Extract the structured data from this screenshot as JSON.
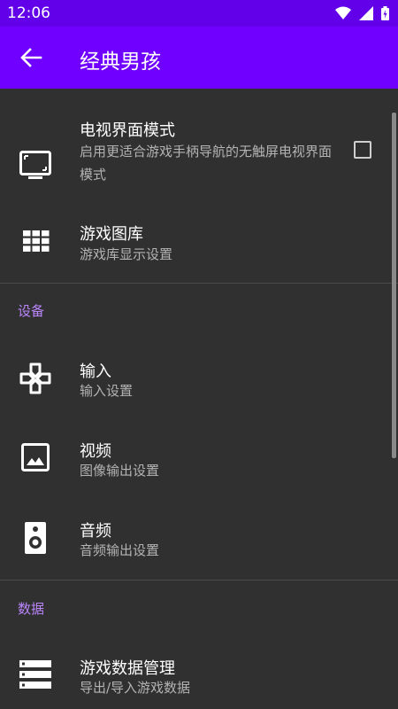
{
  "status_bar": {
    "time": "12:06",
    "icons": [
      "wifi-icon",
      "signal-icon",
      "battery-icon"
    ]
  },
  "app_bar": {
    "title": "经典男孩",
    "back_icon": "arrow-back-icon"
  },
  "sections": {
    "top": {
      "items": [
        {
          "title": "电视界面模式",
          "summary": "启用更适合游戏手柄导航的无触屏电视界面模式",
          "icon": "tv-icon",
          "checked": false
        },
        {
          "title": "游戏图库",
          "summary": "游戏库显示设置",
          "icon": "grid-icon"
        }
      ]
    },
    "devices": {
      "header": "设备",
      "items": [
        {
          "title": "输入",
          "summary": "输入设置",
          "icon": "gamepad-icon"
        },
        {
          "title": "视频",
          "summary": "图像输出设置",
          "icon": "image-icon"
        },
        {
          "title": "音频",
          "summary": "音频输出设置",
          "icon": "speaker-icon"
        }
      ]
    },
    "data": {
      "header": "数据",
      "items": [
        {
          "title": "游戏数据管理",
          "summary": "导出/导入游戏数据",
          "icon": "storage-icon"
        }
      ]
    }
  },
  "colors": {
    "status_bar": "#6200ea",
    "app_bar": "#7000ff",
    "background": "#303030",
    "accent": "#bb86fc"
  }
}
